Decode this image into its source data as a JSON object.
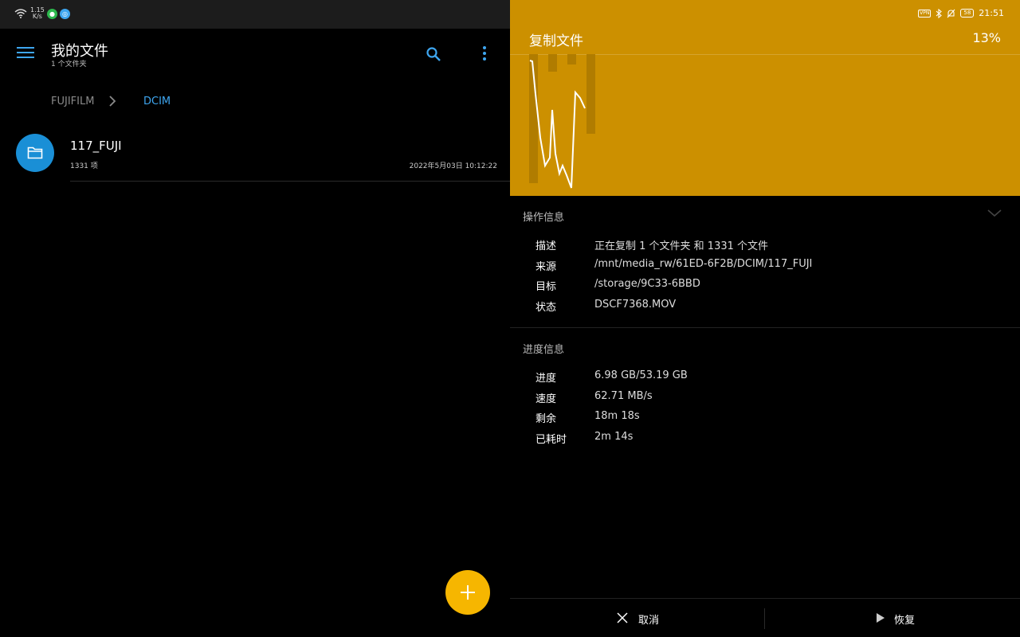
{
  "status_left": {
    "net_rate_top": "1.15",
    "net_rate_bottom": "K/s"
  },
  "status_right": {
    "vpn": "VPN",
    "battery": "58",
    "time": "21:51"
  },
  "app_bar": {
    "title": "我的文件",
    "subtitle": "1 个文件夹"
  },
  "breadcrumb": {
    "parent": "FUJIFILM",
    "current": "DCIM"
  },
  "file": {
    "name": "117_FUJI",
    "count": "1331 项",
    "date": "2022年5月03日 10:12:22"
  },
  "copy_panel": {
    "title": "复制文件",
    "percent": "13%",
    "op_section": "操作信息",
    "op_items": [
      {
        "key": "描述",
        "value": "正在复制 1 个文件夹 和 1331 个文件"
      },
      {
        "key": "来源",
        "value": "/mnt/media_rw/61ED-6F2B/DCIM/117_FUJI"
      },
      {
        "key": "目标",
        "value": "/storage/9C33-6BBD"
      },
      {
        "key": "状态",
        "value": "DSCF7368.MOV"
      }
    ],
    "progress_section": "进度信息",
    "progress_items": [
      {
        "key": "进度",
        "value": "6.98 GB/53.19 GB"
      },
      {
        "key": "速度",
        "value": "62.71 MB/s"
      },
      {
        "key": "剩余",
        "value": "18m 18s"
      },
      {
        "key": "已耗时",
        "value": "2m 14s"
      }
    ],
    "cancel_label": "取消",
    "resume_label": "恢复"
  },
  "colors": {
    "accent": "#3ea6f0",
    "header": "#cc9000",
    "fab": "#f6b600",
    "folder": "#1a8fd6"
  }
}
